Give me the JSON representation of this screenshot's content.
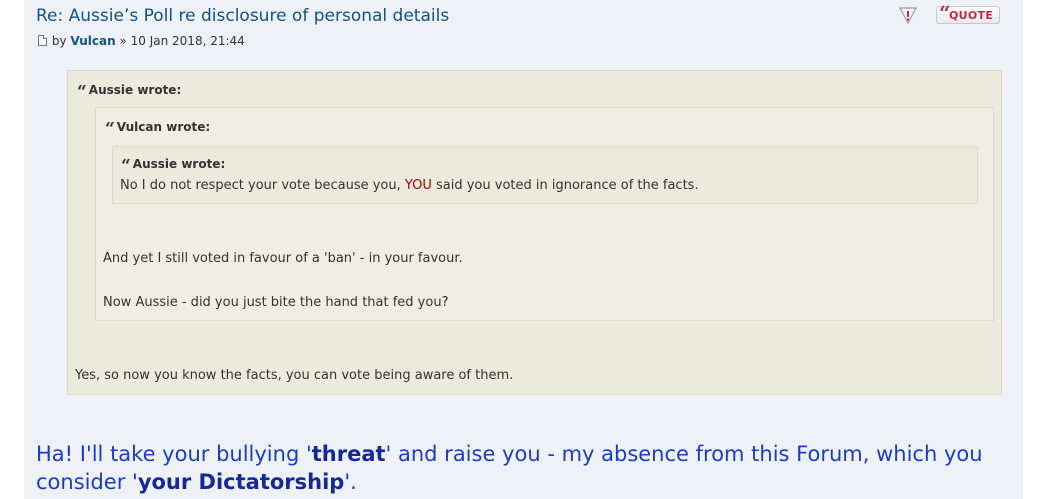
{
  "post": {
    "title": "Re: Aussie’s Poll re disclosure of personal details",
    "by_prefix": "by",
    "author": "Vulcan",
    "date": "» 10 Jan 2018, 21:44",
    "quote_button": "QUOTE",
    "report_icon": "report-icon"
  },
  "quote_outer": {
    "cite": "Aussie wrote:",
    "reply": "Yes, so now you know the facts, you can vote being aware of them."
  },
  "quote_middle": {
    "cite": "Vulcan wrote:",
    "line1": "And yet I still voted in favour of a 'ban' - in your favour.",
    "line2": "Now Aussie - did you just bite the hand that fed you?"
  },
  "quote_inner": {
    "cite": "Aussie wrote:",
    "text_before": "No I do not respect your vote because you, ",
    "text_red": "YOU",
    "text_after": " said you voted in ignorance of the facts."
  },
  "message": {
    "part1": "Ha! I'll take your bullying '",
    "bold1": "threat",
    "part2": "' and raise you - my absence from this Forum, which you consider '",
    "bold2": "your Dictatorship",
    "part3": "'."
  },
  "colors": {
    "title": "#105289",
    "quote_bg": "#ebeadd",
    "post_bg": "#eef2f7",
    "message": "#1a3cc8",
    "emphasis_red": "#aa0000"
  }
}
